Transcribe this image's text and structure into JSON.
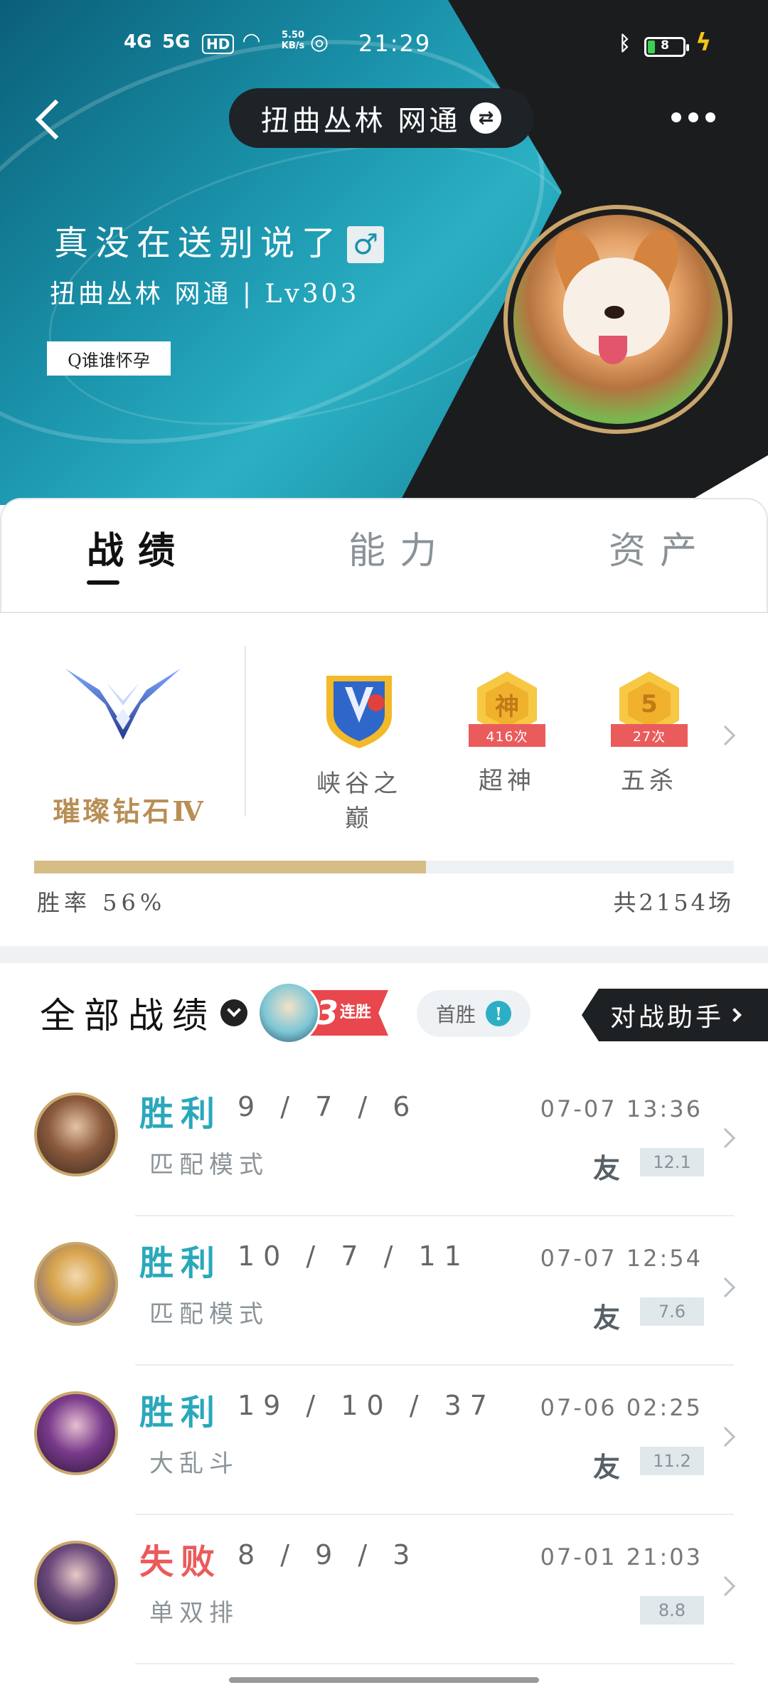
{
  "status_bar": {
    "signal1": "4G",
    "signal2": "5G",
    "hd": "HD",
    "speed": "5.50\nKB/s",
    "time": "21:29",
    "battery": "8"
  },
  "nav": {
    "title": "扭曲丛林 网通"
  },
  "profile": {
    "nickname": "真没在送别说了",
    "gender_symbol": "♂",
    "server_level": "扭曲丛林 网通 | Lv303",
    "signature": "Q谁谁怀孕"
  },
  "tabs": [
    {
      "label": "战绩",
      "active": true
    },
    {
      "label": "能力",
      "active": false
    },
    {
      "label": "资产",
      "active": false
    }
  ],
  "rank": {
    "name": "璀璨钻石Ⅳ",
    "honors": [
      {
        "label": "峡谷之巅",
        "icon": "summit-shield-icon",
        "ribbon": ""
      },
      {
        "label": "超神",
        "icon": "godlike-badge-icon",
        "glyph": "神",
        "ribbon": "416次"
      },
      {
        "label": "五杀",
        "icon": "pentakill-badge-icon",
        "glyph": "5",
        "ribbon": "27次"
      }
    ],
    "win_rate_label": "胜率 56%",
    "win_rate": 0.56,
    "total_games": "共2154场"
  },
  "records": {
    "title": "全部战绩",
    "streak_number": "3",
    "streak_text": "连胜",
    "first_win": "首胜",
    "first_win_info": "!",
    "assistant": "对战助手"
  },
  "matches": [
    {
      "result": "胜利",
      "kda": "9 / 7 / 6",
      "mode": "匹配模式",
      "time": "07-07 13:36",
      "friend": "友",
      "score": "12.1",
      "win": true
    },
    {
      "result": "胜利",
      "kda": "10 / 7 / 11",
      "mode": "匹配模式",
      "time": "07-07 12:54",
      "friend": "友",
      "score": "7.6",
      "win": true
    },
    {
      "result": "胜利",
      "kda": "19 / 10 / 37",
      "mode": "大乱斗",
      "time": "07-06 02:25",
      "friend": "友",
      "score": "11.2",
      "win": true
    },
    {
      "result": "失败",
      "kda": "8 / 9 / 3",
      "mode": "单双排",
      "time": "07-01 21:03",
      "friend": "",
      "score": "8.8",
      "win": false
    }
  ],
  "colors": {
    "win": "#2aa8bb",
    "lose": "#ea5b5b",
    "rank_gold": "#b88e55",
    "progress_fill": "#d6bd86"
  }
}
